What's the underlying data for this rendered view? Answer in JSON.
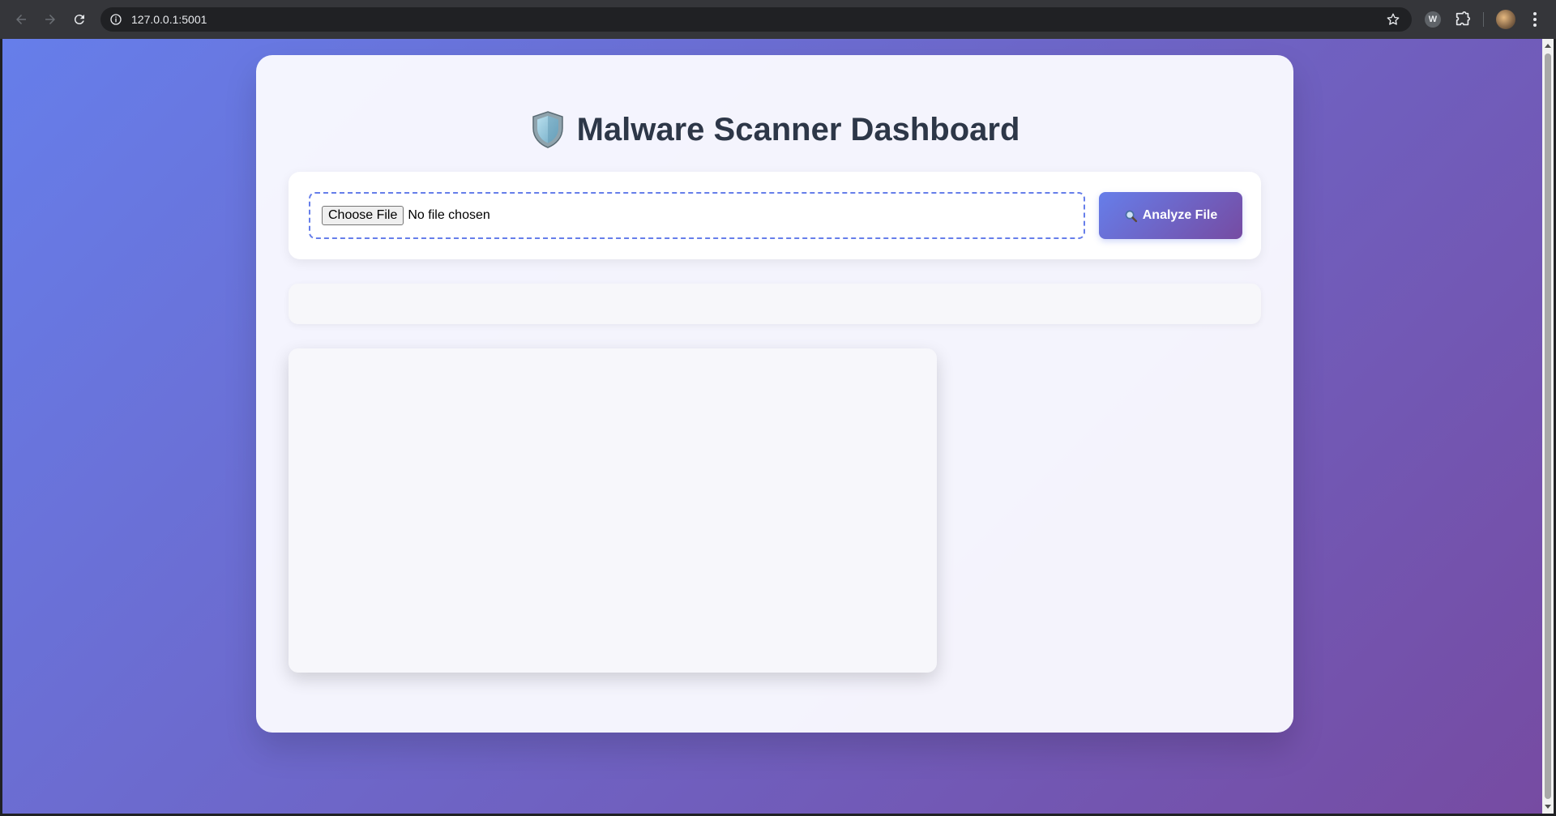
{
  "browser": {
    "url": "127.0.0.1:5001",
    "extension_badge": "W"
  },
  "page": {
    "title": "Malware Scanner Dashboard",
    "title_icon": "shield-icon"
  },
  "upload": {
    "choose_label": "Choose File",
    "file_status": "No file chosen",
    "analyze_label": "Analyze File",
    "analyze_icon": "magnifier-icon"
  },
  "colors": {
    "gradient_start": "#667eea",
    "gradient_end": "#764ba2",
    "title_text": "#2d3748"
  }
}
